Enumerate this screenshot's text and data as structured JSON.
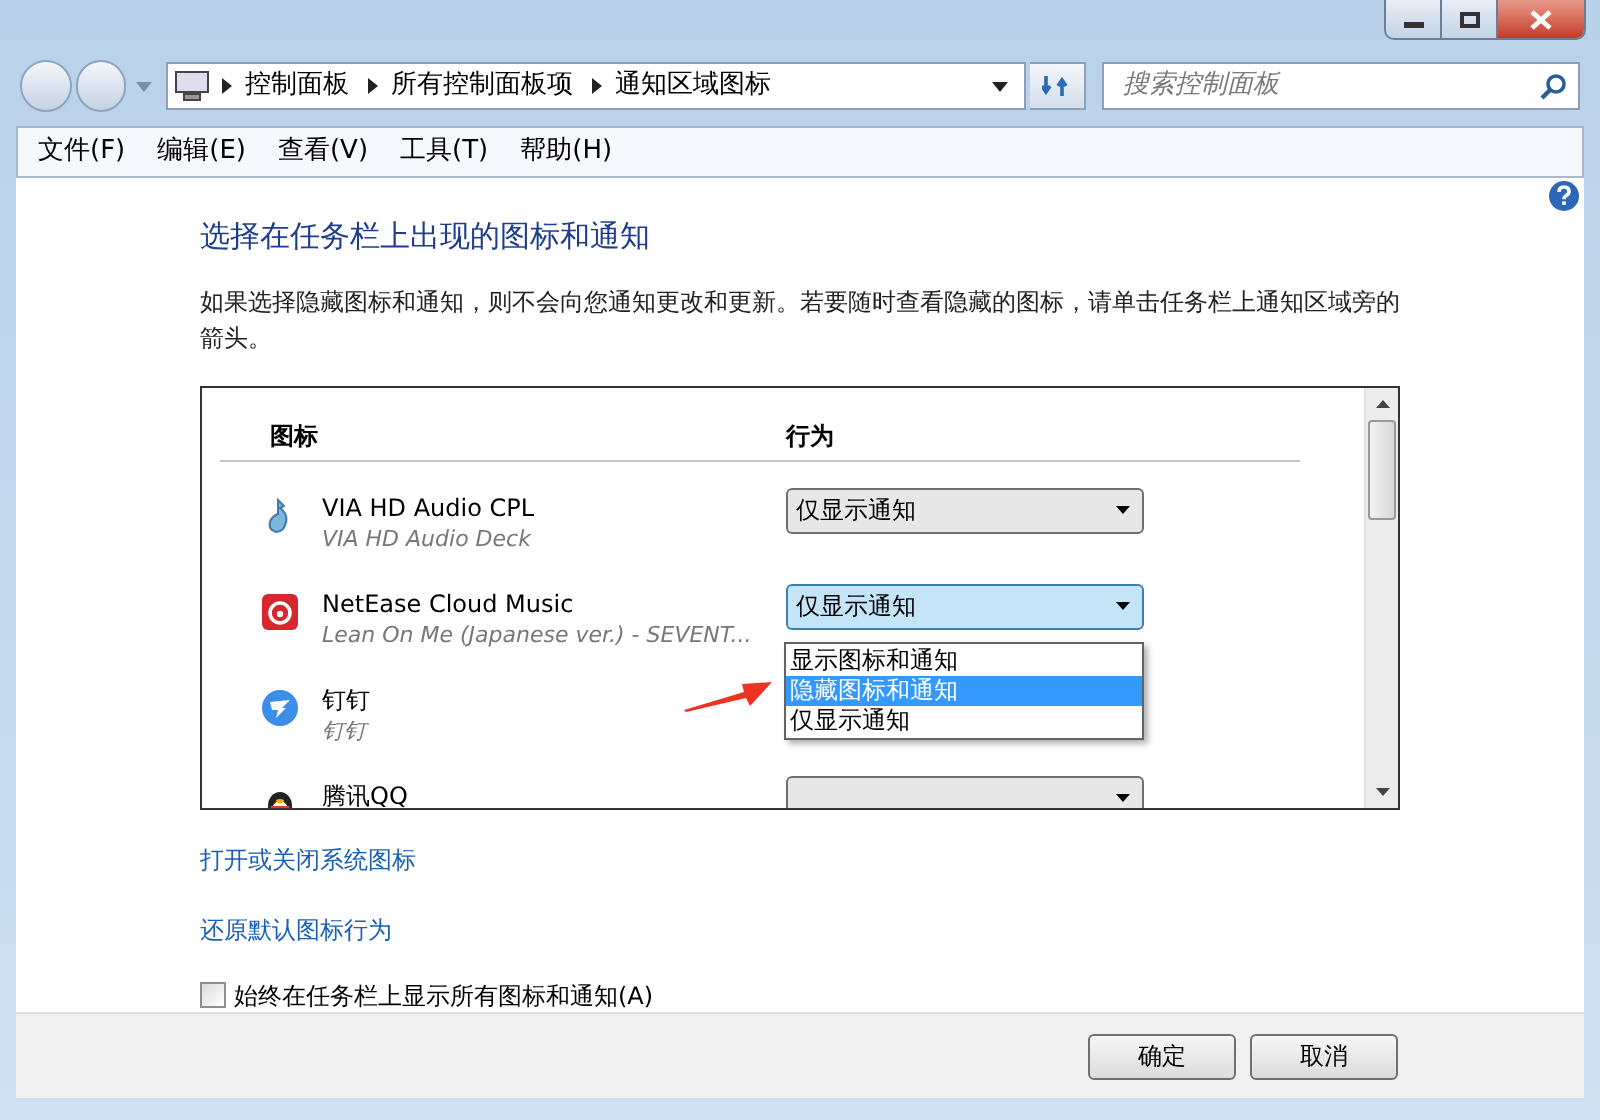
{
  "address_bar": {
    "path": [
      "控制面板",
      "所有控制面板项",
      "通知区域图标"
    ],
    "search_placeholder": "搜索控制面板"
  },
  "menu": [
    "文件(F)",
    "编辑(E)",
    "查看(V)",
    "工具(T)",
    "帮助(H)"
  ],
  "heading": "选择在任务栏上出现的图标和通知",
  "description": "如果选择隐藏图标和通知，则不会向您通知更改和更新。若要随时查看隐藏的图标，请单击任务栏上通知区域旁的箭头。",
  "table": {
    "columns": [
      "图标",
      "行为"
    ],
    "rows": [
      {
        "kind": "speaker",
        "name": "VIA HD Audio CPL",
        "subtitle": "VIA HD Audio Deck",
        "behavior": "仅显示通知",
        "open": false
      },
      {
        "kind": "music",
        "name": "NetEase Cloud Music",
        "subtitle": "Lean On Me (Japanese ver.) - SEVENT...",
        "behavior": "仅显示通知",
        "open": true
      },
      {
        "kind": "wing",
        "name": "钉钉",
        "subtitle": "钉钉"
      },
      {
        "kind": "penguin",
        "name": "腾讯QQ",
        "open": false
      }
    ]
  },
  "dropdown_options": [
    {
      "label": "显示图标和通知",
      "selected": false
    },
    {
      "label": "隐藏图标和通知",
      "selected": true
    },
    {
      "label": "仅显示通知",
      "selected": false
    }
  ],
  "links": [
    "打开或关闭系统图标",
    "还原默认图标行为"
  ],
  "checkbox": {
    "label": "始终在任务栏上显示所有图标和通知(A)",
    "checked": false
  },
  "buttons": [
    "确定",
    "取消"
  ]
}
